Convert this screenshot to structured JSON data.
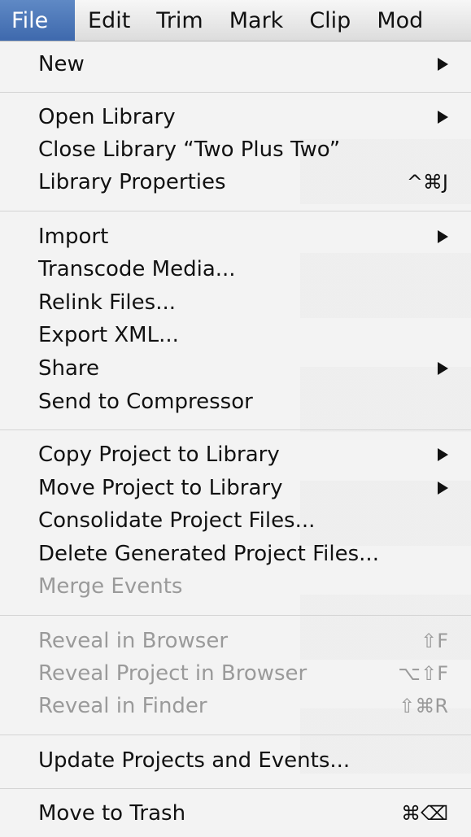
{
  "menubar": {
    "items": [
      {
        "label": "File"
      },
      {
        "label": "Edit"
      },
      {
        "label": "Trim"
      },
      {
        "label": "Mark"
      },
      {
        "label": "Clip"
      },
      {
        "label": "Mod"
      }
    ]
  },
  "file_menu": {
    "items": [
      {
        "label": "New",
        "shortcut": "",
        "submenu": true,
        "enabled": true
      },
      {
        "label": "Open Library",
        "shortcut": "",
        "submenu": true,
        "enabled": true
      },
      {
        "label": "Close Library “Two Plus Two”",
        "shortcut": "",
        "submenu": false,
        "enabled": true
      },
      {
        "label": "Library Properties",
        "shortcut": "^⌘J",
        "submenu": false,
        "enabled": true
      },
      {
        "label": "Import",
        "shortcut": "",
        "submenu": true,
        "enabled": true
      },
      {
        "label": "Transcode Media...",
        "shortcut": "",
        "submenu": false,
        "enabled": true
      },
      {
        "label": "Relink Files...",
        "shortcut": "",
        "submenu": false,
        "enabled": true
      },
      {
        "label": "Export XML...",
        "shortcut": "",
        "submenu": false,
        "enabled": true
      },
      {
        "label": "Share",
        "shortcut": "",
        "submenu": true,
        "enabled": true
      },
      {
        "label": "Send to Compressor",
        "shortcut": "",
        "submenu": false,
        "enabled": true
      },
      {
        "label": "Copy Project to Library",
        "shortcut": "",
        "submenu": true,
        "enabled": true
      },
      {
        "label": "Move Project to Library",
        "shortcut": "",
        "submenu": true,
        "enabled": true
      },
      {
        "label": "Consolidate Project Files...",
        "shortcut": "",
        "submenu": false,
        "enabled": true
      },
      {
        "label": "Delete Generated Project Files...",
        "shortcut": "",
        "submenu": false,
        "enabled": true
      },
      {
        "label": "Merge Events",
        "shortcut": "",
        "submenu": false,
        "enabled": false
      },
      {
        "label": "Reveal in Browser",
        "shortcut": "⇧F",
        "submenu": false,
        "enabled": false
      },
      {
        "label": "Reveal Project in Browser",
        "shortcut": "⌥⇧F",
        "submenu": false,
        "enabled": false
      },
      {
        "label": "Reveal in Finder",
        "shortcut": "⇧⌘R",
        "submenu": false,
        "enabled": false
      },
      {
        "label": "Update Projects and Events...",
        "shortcut": "",
        "submenu": false,
        "enabled": true
      },
      {
        "label": "Move to Trash",
        "shortcut": "⌘⌫",
        "submenu": false,
        "enabled": true
      }
    ]
  },
  "colors": {
    "active_menu_bg": "#4a76b8",
    "disabled_text": "#9a9a9a",
    "menu_bg": "#f3f3f3"
  }
}
